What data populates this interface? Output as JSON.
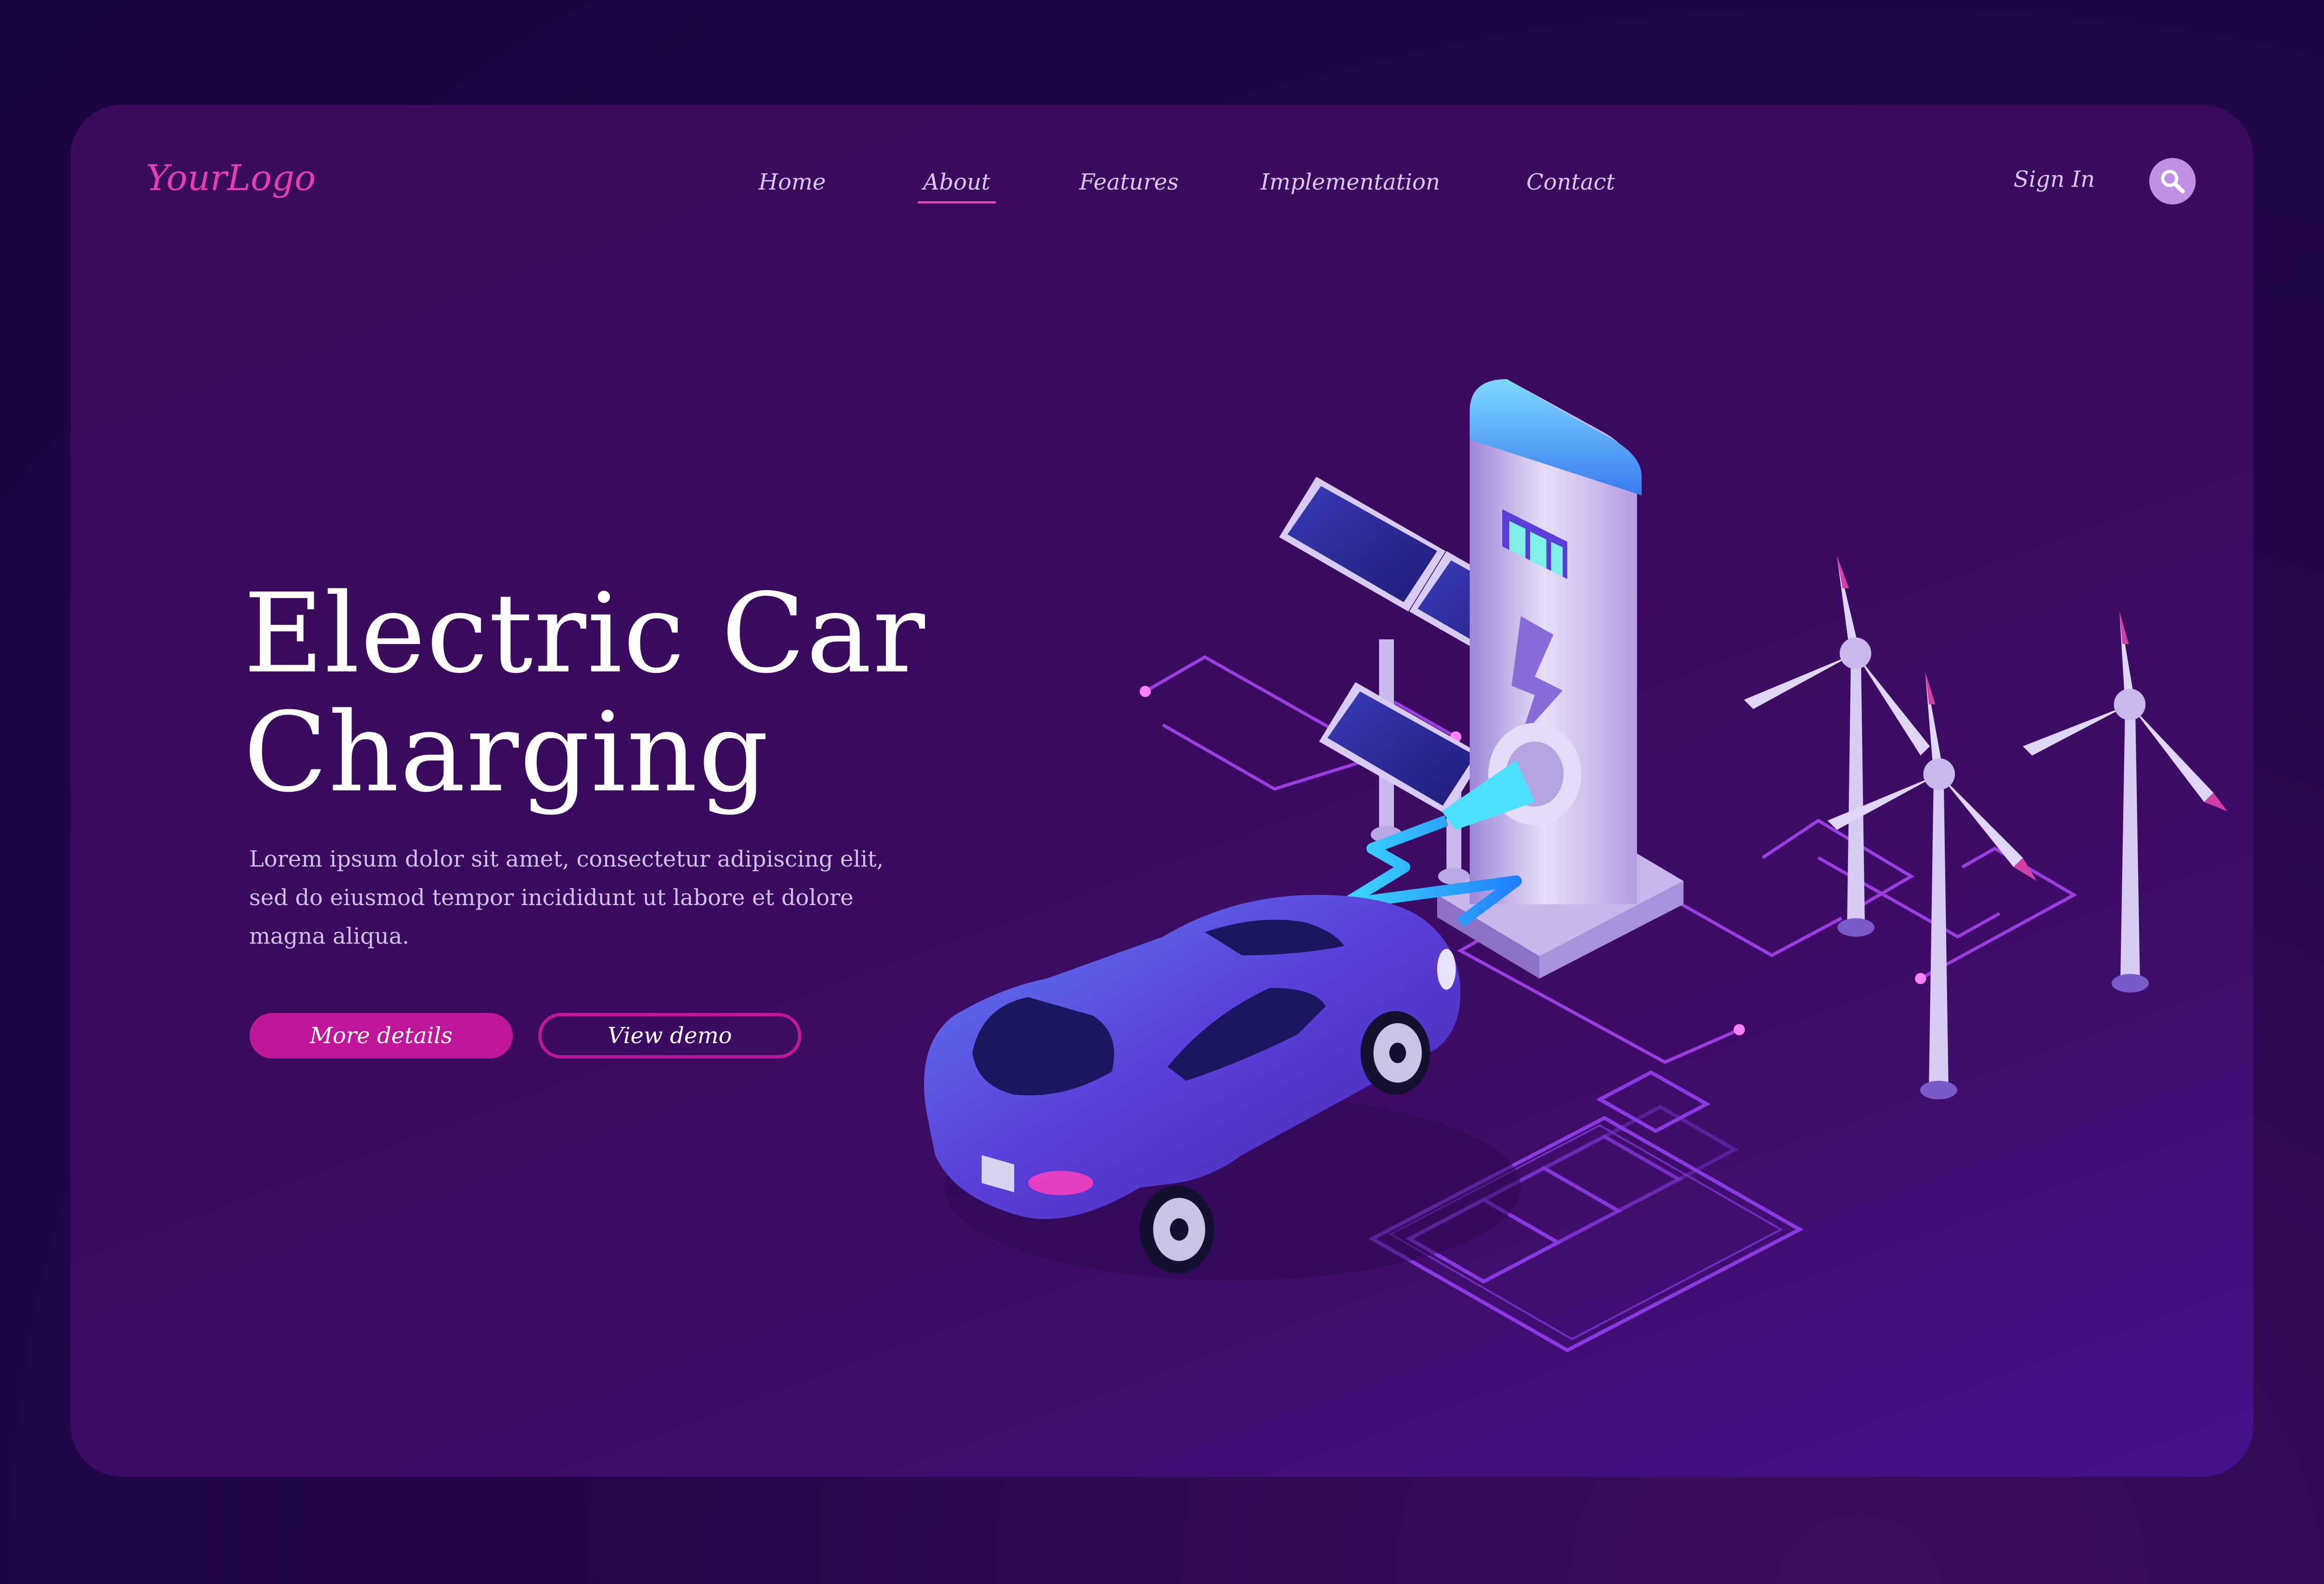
{
  "header": {
    "logo": "YourLogo",
    "nav": [
      {
        "label": "Home",
        "active": false
      },
      {
        "label": "About",
        "active": true
      },
      {
        "label": "Features",
        "active": false
      },
      {
        "label": "Implementation",
        "active": false
      },
      {
        "label": "Contact",
        "active": false
      }
    ],
    "sign_in": "Sign In",
    "search_icon": "search-icon"
  },
  "hero": {
    "title_line1": "Electric Car",
    "title_line2": "Charging",
    "description": "Lorem ipsum dolor sit amet, consectetur adipiscing elit, sed do eiusmod tempor incididunt ut labore et dolore magna aliqua.",
    "primary_button": "More details",
    "secondary_button": "View demo"
  },
  "colors": {
    "accent": "#c0169c",
    "logo": "#e040b0",
    "background": "#3c0c5c",
    "car": "#5a3ed8"
  },
  "illustration": {
    "elements": [
      "electric-car",
      "charging-station",
      "solar-panels",
      "wind-turbines",
      "battery-outline",
      "circuit-lines"
    ]
  }
}
